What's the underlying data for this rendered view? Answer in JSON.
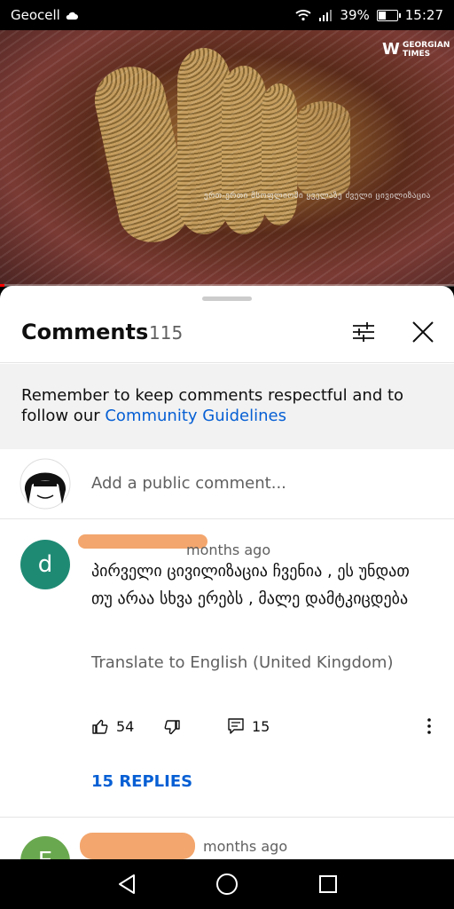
{
  "status": {
    "carrier": "Geocell",
    "battery": "39%",
    "time": "15:27",
    "battery_level": 0.39
  },
  "video": {
    "channel_logo_text": "GEORGIAN TIMES",
    "caption": "ერთ-ერთი მსოფლიოში ყველაზე ძველი ცივილიზაცია",
    "progress": 0.01
  },
  "comments_panel": {
    "title": "Comments",
    "count": "115",
    "notice_text": "Remember to keep comments respectful and to follow our ",
    "notice_link": "Community Guidelines",
    "add_comment_placeholder": "Add a public comment...",
    "comments": [
      {
        "avatar_letter": "d",
        "avatar_color": "#1f8a74",
        "time": "months ago",
        "text": "პირველი ცივილიზაცია ჩვენია , ეს უნდათ თუ  არაა სხვა ერებს , მალე დამტკიცდება",
        "translate": "Translate to English (United Kingdom)",
        "likes": "54",
        "replies_count": "15",
        "replies_label": "15 REPLIES"
      },
      {
        "avatar_letter": "E",
        "avatar_color": "#6aa84f",
        "time": "months ago"
      }
    ]
  },
  "icons": {
    "filter": "sliders-icon",
    "close": "close-icon",
    "like": "thumbs-up-icon",
    "dislike": "thumbs-down-icon",
    "reply": "reply-icon",
    "more": "more-vert-icon",
    "back": "nav-back-icon",
    "home": "nav-home-icon",
    "recents": "nav-recents-icon"
  },
  "colors": {
    "link": "#065fd4",
    "redaction": "#f2a165"
  }
}
